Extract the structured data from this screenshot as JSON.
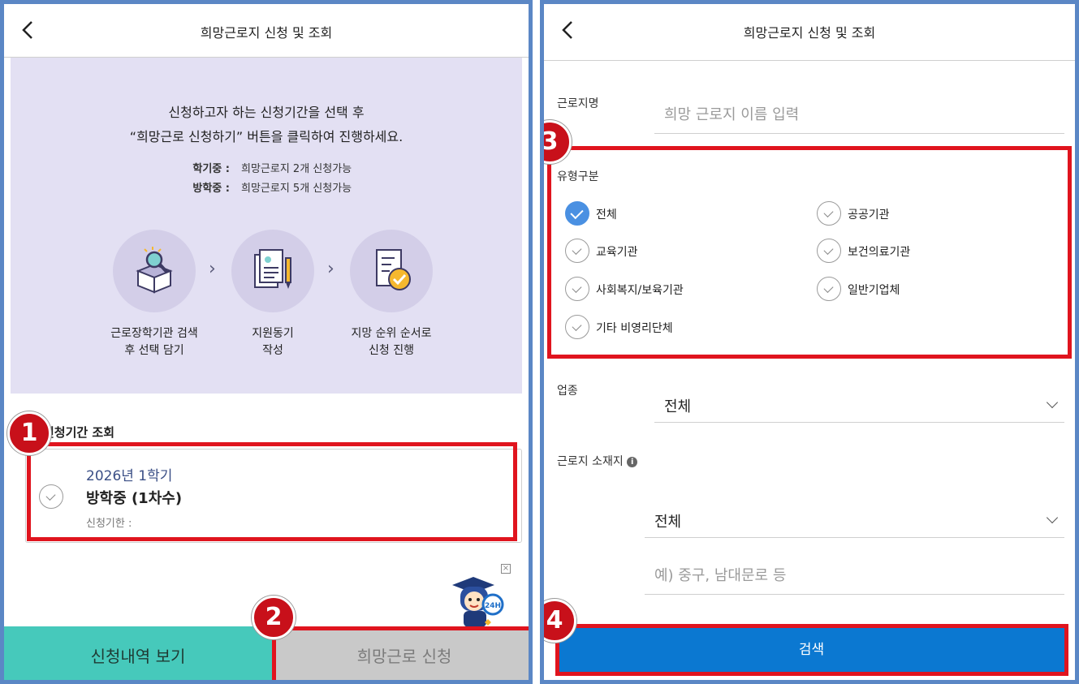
{
  "left": {
    "header": {
      "title": "희망근로지 신청 및 조회"
    },
    "intro": {
      "line1": "신청하고자 하는 신청기간을 선택 후",
      "line2": "“희망근로 신청하기” 버튼을 클릭하여 진행하세요.",
      "rules": [
        {
          "key": "학기중 :",
          "value": "희망근로지 2개 신청가능"
        },
        {
          "key": "방학중 :",
          "value": "희망근로지 5개 신청가능"
        }
      ],
      "steps": [
        {
          "line1": "근로장학기관 검색",
          "line2": "후 선택 담기"
        },
        {
          "line1": "지원동기",
          "line2": "작성"
        },
        {
          "line1": "지망 순위 순서로",
          "line2": "신청 진행"
        }
      ]
    },
    "period": {
      "section_label": "신청기간 조회",
      "year": "2026년 1학기",
      "name": "방학중 (1차수)",
      "deadline": "신청기한 :"
    },
    "buttons": {
      "history": "신청내역 보기",
      "apply": "희망근로 신청"
    }
  },
  "right": {
    "header": {
      "title": "희망근로지 신청 및 조회"
    },
    "workplace": {
      "label": "근로지명",
      "placeholder": "희망 근로지 이름 입력"
    },
    "types": {
      "label": "유형구분",
      "options": [
        {
          "label": "전체",
          "checked": true
        },
        {
          "label": "공공기관",
          "checked": false
        },
        {
          "label": "교육기관",
          "checked": false
        },
        {
          "label": "보건의료기관",
          "checked": false
        },
        {
          "label": "사회복지/보육기관",
          "checked": false
        },
        {
          "label": "일반기업체",
          "checked": false
        },
        {
          "label": "기타 비영리단체",
          "checked": false
        }
      ]
    },
    "industry": {
      "label": "업종",
      "value": "전체"
    },
    "location": {
      "label": "근로지 소재지",
      "value": "전체",
      "placeholder": "예) 중구, 남대문로 등"
    },
    "search_button": "검색"
  },
  "annotations": [
    "1",
    "2",
    "3",
    "4"
  ],
  "colors": {
    "accent_blue": "#0b78d1",
    "teal": "#46c9bb",
    "highlight_red": "#e0141e",
    "intro_bg": "#e3e0f3"
  }
}
